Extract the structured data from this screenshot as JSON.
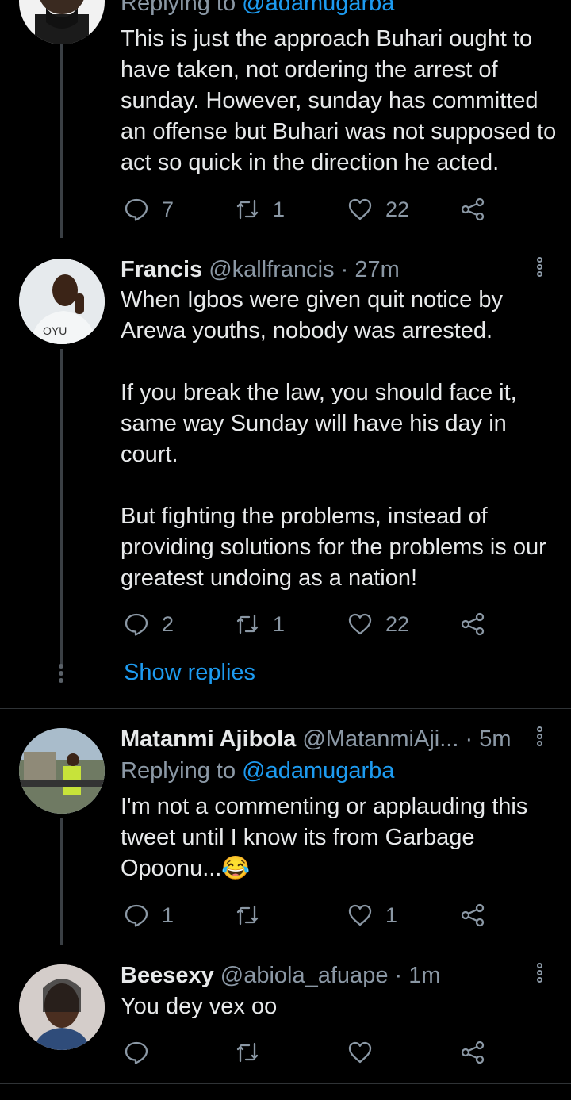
{
  "tweets": [
    {
      "replying_prefix": "Replying to ",
      "replying_mention": "@adamugarba",
      "text": "This is just the approach Buhari ought to have taken, not ordering the arrest of sunday. However, sunday has committed an offense but Buhari was not supposed to act so quick in the direction he acted.",
      "reply_count": "7",
      "retweet_count": "1",
      "like_count": "22"
    },
    {
      "name": "Francis",
      "handle": "@kallfrancis",
      "separator": "·",
      "time": "27m",
      "text": "When Igbos were given quit notice by Arewa youths, nobody was arrested.\n\nIf you break the law, you should face it, same way Sunday will have his day in court.\n\nBut fighting the problems, instead of providing solutions for the problems is our greatest undoing as a nation!",
      "reply_count": "2",
      "retweet_count": "1",
      "like_count": "22",
      "show_replies": "Show replies"
    },
    {
      "name": "Matanmi Ajibola",
      "handle": "@MatanmiAji...",
      "separator": "·",
      "time": "5m",
      "replying_prefix": "Replying to ",
      "replying_mention": "@adamugarba",
      "text": "I'm not a commenting or applauding this tweet until I know its from Garbage Opoonu...😂",
      "reply_count": "1",
      "retweet_count": "",
      "like_count": "1"
    },
    {
      "name": "Beesexy",
      "handle": "@abiola_afuape",
      "separator": "·",
      "time": "1m",
      "text": "You dey vex oo",
      "reply_count": "",
      "retweet_count": "",
      "like_count": ""
    }
  ],
  "icons": {
    "reply": "reply-icon",
    "retweet": "retweet-icon",
    "like": "heart-icon",
    "share": "share-icon",
    "more": "more-vertical-icon"
  },
  "colors": {
    "background": "#000000",
    "text": "#e7e9ea",
    "secondary": "#8b98a5",
    "accent": "#1d9bf0"
  }
}
